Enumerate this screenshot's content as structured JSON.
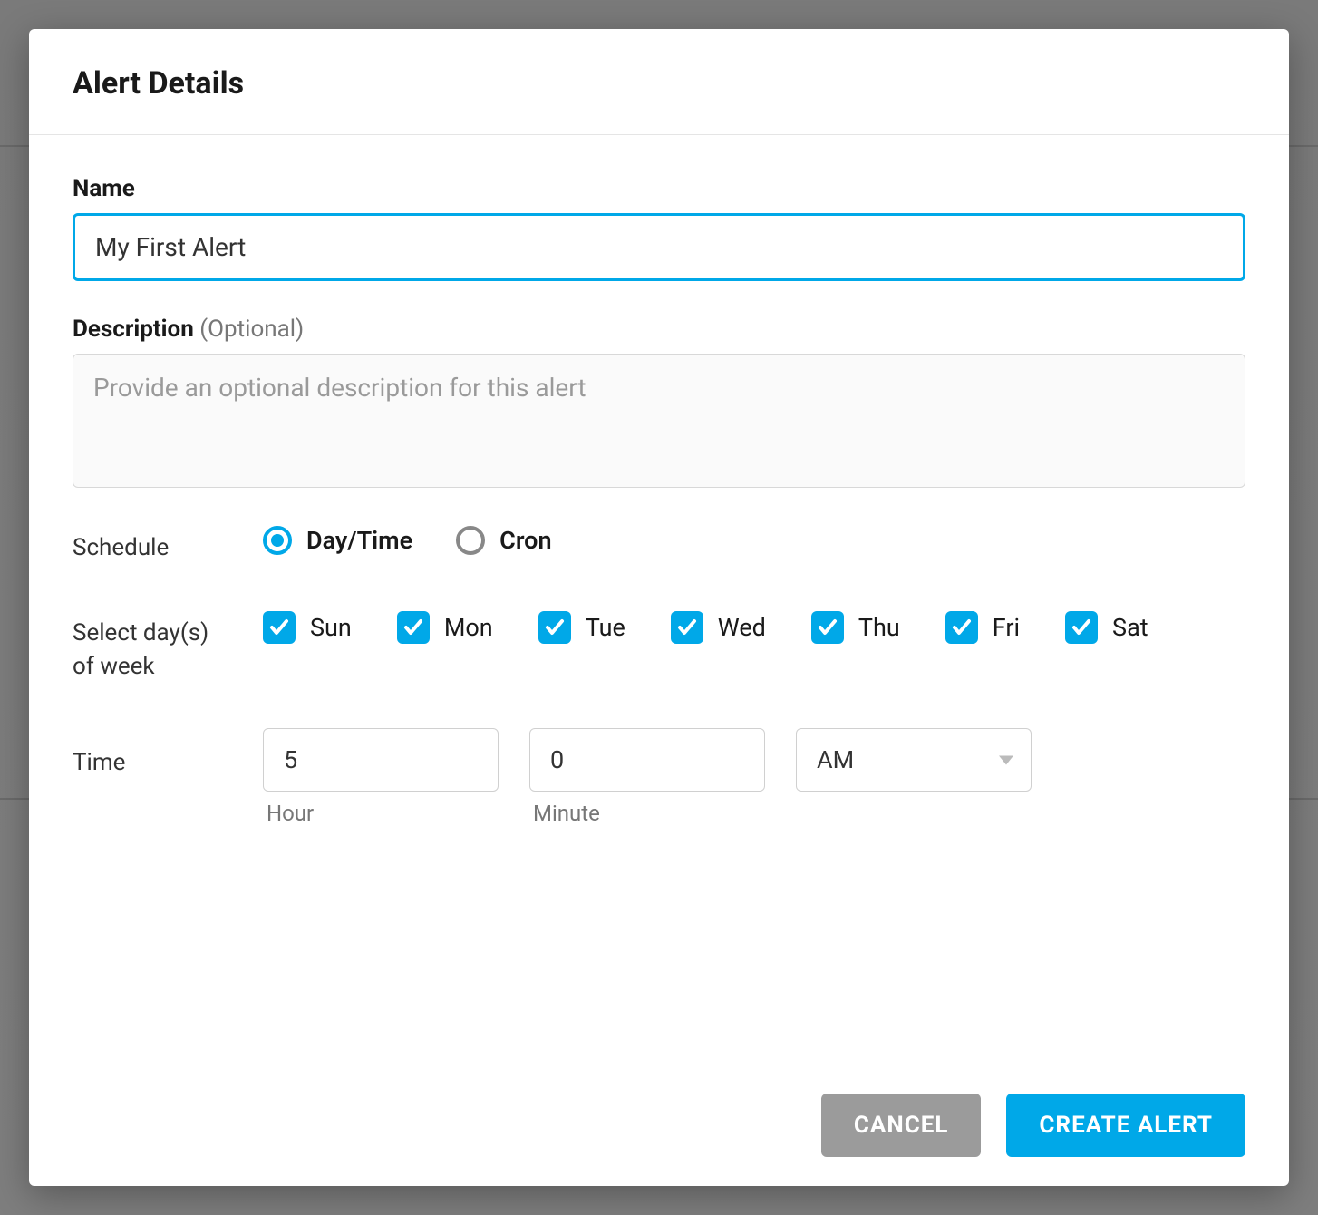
{
  "modal": {
    "title": "Alert Details"
  },
  "form": {
    "name": {
      "label": "Name",
      "value": "My First Alert"
    },
    "description": {
      "label": "Description",
      "suffix": "(Optional)",
      "placeholder": "Provide an optional description for this alert",
      "value": ""
    },
    "schedule": {
      "label": "Schedule",
      "options": {
        "daytime": {
          "label": "Day/Time",
          "checked": true
        },
        "cron": {
          "label": "Cron",
          "checked": false
        }
      }
    },
    "days": {
      "label": "Select day(s) of week",
      "items": [
        {
          "label": "Sun",
          "checked": true
        },
        {
          "label": "Mon",
          "checked": true
        },
        {
          "label": "Tue",
          "checked": true
        },
        {
          "label": "Wed",
          "checked": true
        },
        {
          "label": "Thu",
          "checked": true
        },
        {
          "label": "Fri",
          "checked": true
        },
        {
          "label": "Sat",
          "checked": true
        }
      ]
    },
    "time": {
      "label": "Time",
      "hour": {
        "value": "5",
        "sublabel": "Hour"
      },
      "minute": {
        "value": "0",
        "sublabel": "Minute"
      },
      "ampm": {
        "value": "AM"
      }
    }
  },
  "footer": {
    "cancel": "CANCEL",
    "submit": "CREATE ALERT"
  }
}
